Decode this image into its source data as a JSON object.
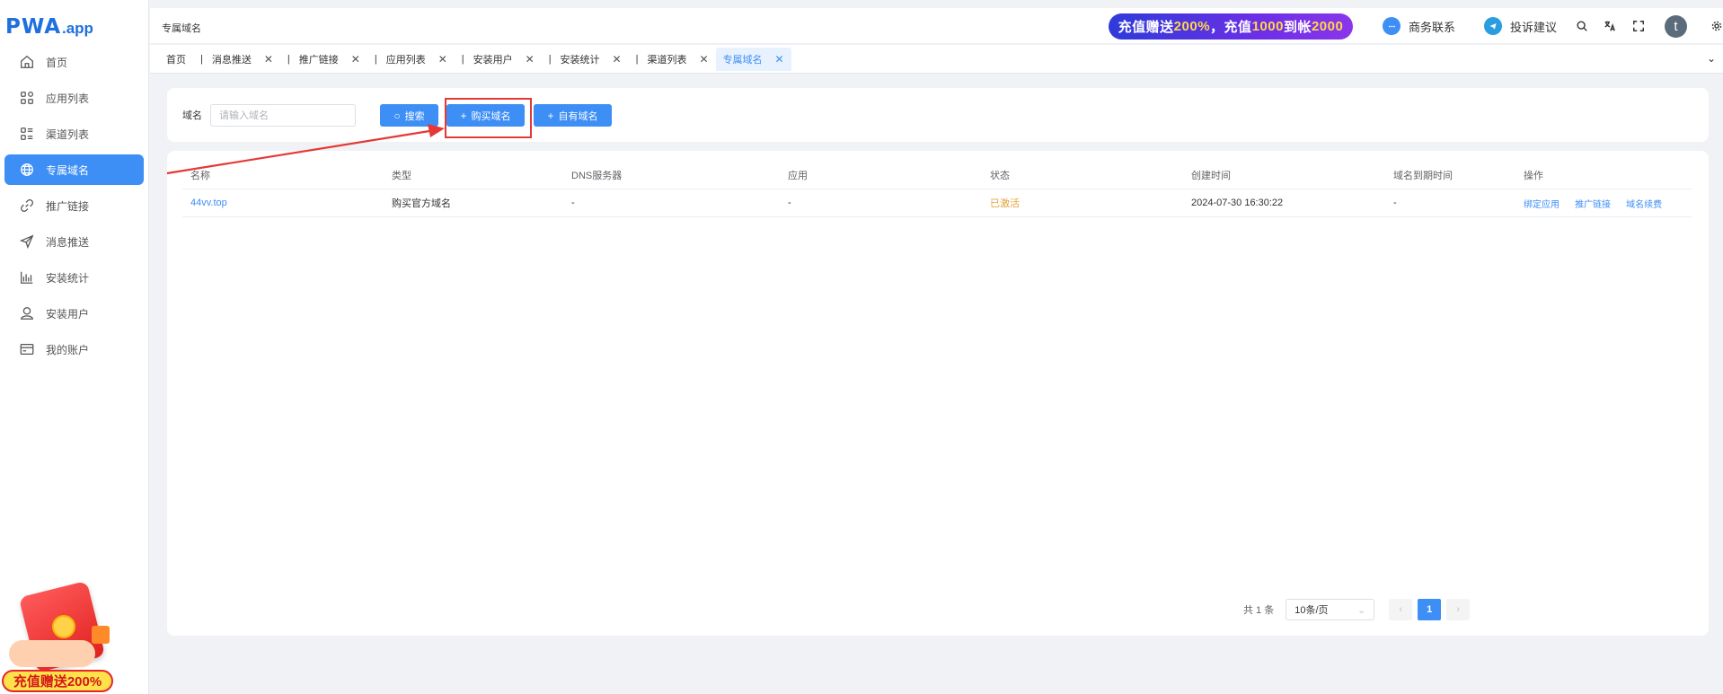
{
  "app": {
    "logo_mark": "PWA",
    "logo_suffix": ".app"
  },
  "sidebar": {
    "items": [
      {
        "label": "首页",
        "icon": "home-icon"
      },
      {
        "label": "应用列表",
        "icon": "grid-icon"
      },
      {
        "label": "渠道列表",
        "icon": "list-icon"
      },
      {
        "label": "专属域名",
        "icon": "globe-icon",
        "active": true
      },
      {
        "label": "推广链接",
        "icon": "link-icon"
      },
      {
        "label": "消息推送",
        "icon": "send-icon"
      },
      {
        "label": "安装统计",
        "icon": "bar-chart-icon"
      },
      {
        "label": "安装用户",
        "icon": "user-icon"
      },
      {
        "label": "我的账户",
        "icon": "wallet-icon"
      }
    ],
    "promo_text": "充值赠送200%"
  },
  "header": {
    "title": "专属域名",
    "banner_part1": "充值赠送",
    "banner_hl1": "200%",
    "banner_part2": "，充值",
    "banner_hl2": "1000",
    "banner_part3": "到帐",
    "banner_hl3": "2000",
    "business_contact": "商务联系",
    "feedback": "投诉建议",
    "avatar_letter": "t"
  },
  "tabs": [
    {
      "label": "首页",
      "closable": false
    },
    {
      "label": "消息推送",
      "closable": true
    },
    {
      "label": "推广链接",
      "closable": true
    },
    {
      "label": "应用列表",
      "closable": true
    },
    {
      "label": "安装用户",
      "closable": true
    },
    {
      "label": "安装统计",
      "closable": true
    },
    {
      "label": "渠道列表",
      "closable": true
    },
    {
      "label": "专属域名",
      "closable": true,
      "active": true
    }
  ],
  "search": {
    "label": "域名",
    "placeholder": "请输入域名",
    "search_btn": "搜索",
    "buy_btn": "购买域名",
    "own_btn": "自有域名"
  },
  "table": {
    "columns": [
      "名称",
      "类型",
      "DNS服务器",
      "应用",
      "状态",
      "创建时间",
      "域名到期时间",
      "操作"
    ],
    "rows": [
      {
        "name": "44vv.top",
        "type": "购买官方域名",
        "dns": "-",
        "app": "-",
        "status": "已激活",
        "created": "2024-07-30 16:30:22",
        "expires": "-",
        "actions": [
          "绑定应用",
          "推广链接",
          "域名续费"
        ]
      }
    ]
  },
  "pagination": {
    "total": "共 1 条",
    "page_size": "10条/页",
    "current_page": "1"
  },
  "colors": {
    "primary": "#3d8ef5",
    "status_active": "#e6a23c",
    "annotation": "#e53935"
  }
}
